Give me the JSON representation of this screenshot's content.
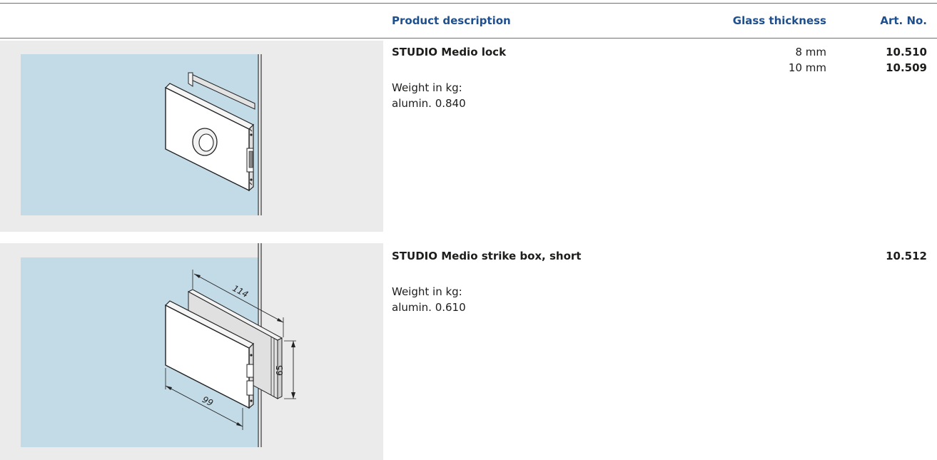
{
  "header": {
    "product_description": "Product description",
    "glass_thickness": "Glass thickness",
    "art_no": "Art. No."
  },
  "products": [
    {
      "title": "STUDIO Medio lock",
      "weight_label": "Weight in kg:",
      "weight_value": "alumin. 0.840",
      "thicknesses": [
        "8 mm",
        "10 mm"
      ],
      "art_numbers": [
        "10.510",
        "10.509"
      ]
    },
    {
      "title": "STUDIO Medio strike box, short",
      "weight_label": "Weight in kg:",
      "weight_value": "alumin. 0.610",
      "art_numbers": [
        "10.512"
      ],
      "dimensions": [
        "114",
        "65",
        "99"
      ]
    }
  ],
  "colors": {
    "header_text": "#1f4f8c",
    "glass": "#c2dbe7",
    "image_bg": "#ebebeb"
  }
}
